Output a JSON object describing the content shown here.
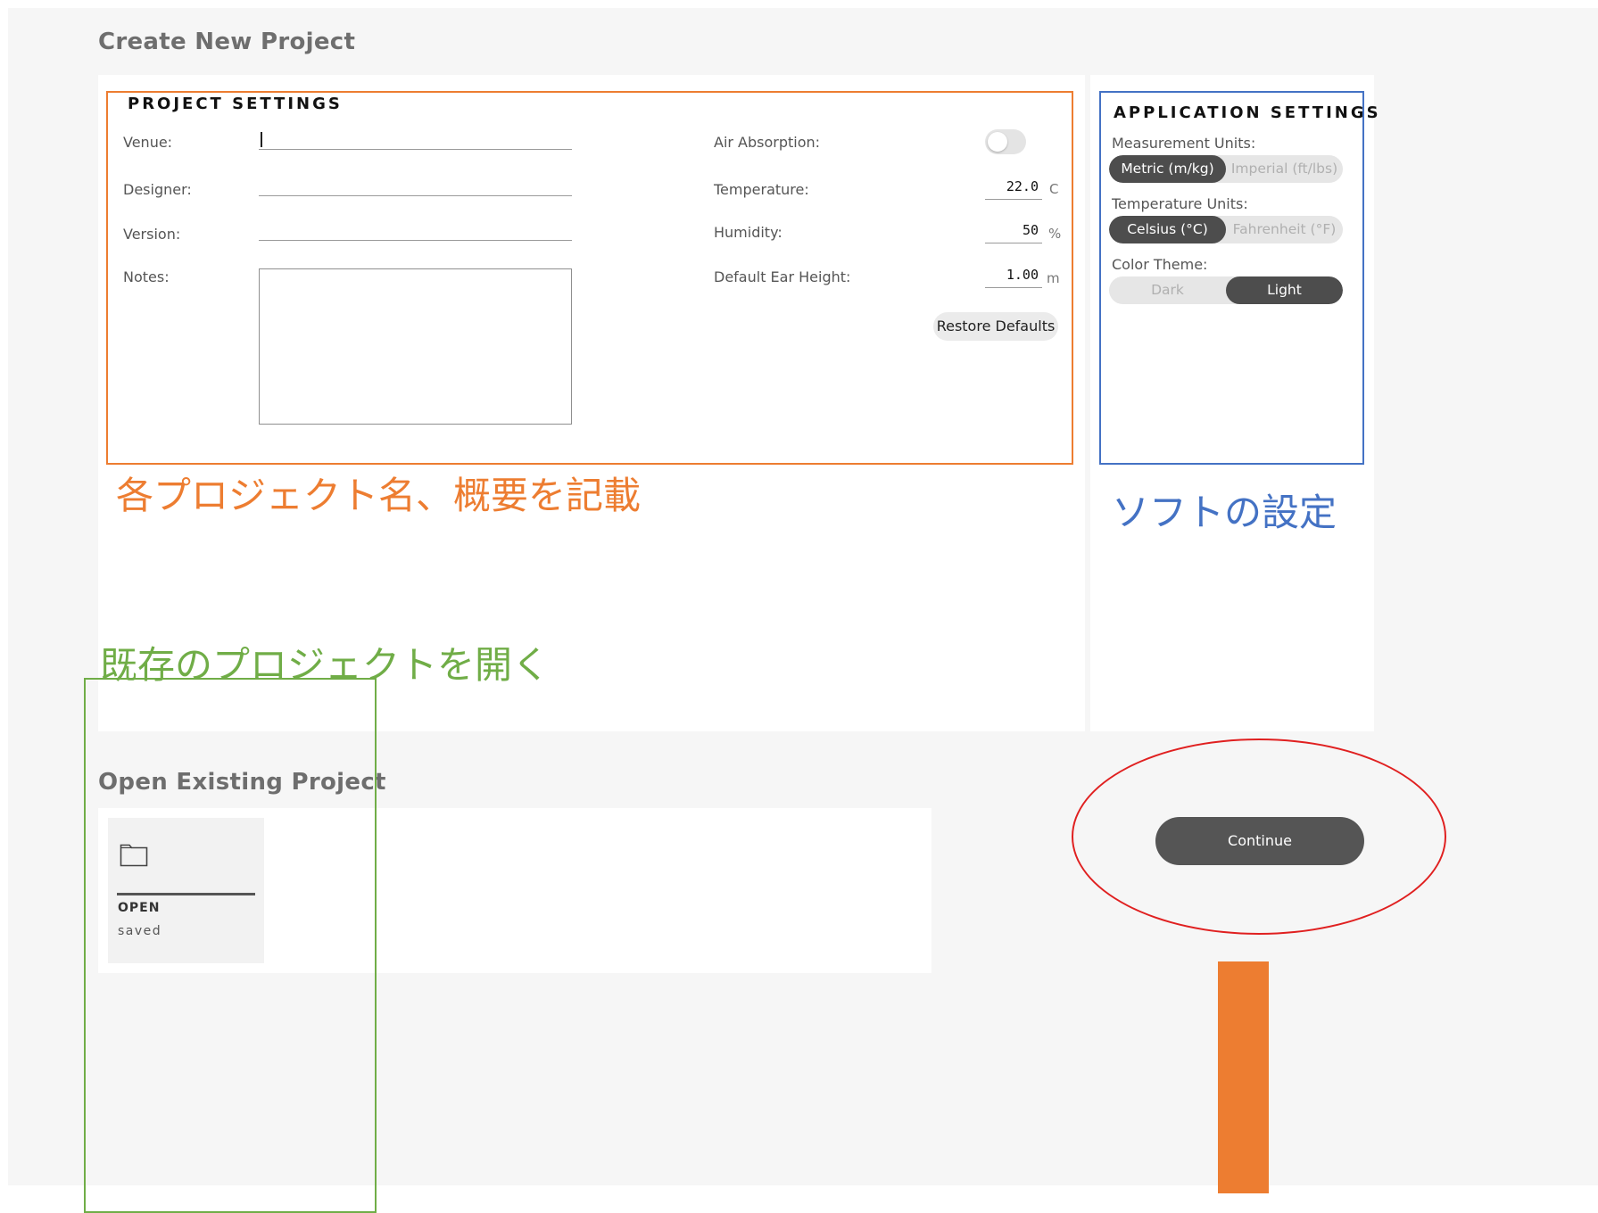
{
  "create_section": {
    "title": "Create New Project"
  },
  "project_settings": {
    "heading": "PROJECT SETTINGS",
    "venue_label": "Venue:",
    "venue_value": "",
    "designer_label": "Designer:",
    "designer_value": "",
    "version_label": "Version:",
    "version_value": "",
    "notes_label": "Notes:",
    "notes_value": "",
    "air_absorption_label": "Air Absorption:",
    "air_absorption_on": false,
    "temperature_label": "Temperature:",
    "temperature_value": "22.0",
    "temperature_unit": "C",
    "humidity_label": "Humidity:",
    "humidity_value": "50",
    "humidity_unit": "%",
    "ear_height_label": "Default Ear Height:",
    "ear_height_value": "1.00",
    "ear_height_unit": "m",
    "restore_label": "Restore Defaults"
  },
  "application_settings": {
    "heading": "APPLICATION SETTINGS",
    "measurement_label": "Measurement Units:",
    "measurement_options": [
      "Metric (m/kg)",
      "Imperial (ft/lbs)"
    ],
    "measurement_selected": "Metric (m/kg)",
    "temperature_label": "Temperature Units:",
    "temperature_options": [
      "Celsius (°C)",
      "Fahrenheit (°F)"
    ],
    "temperature_selected": "Celsius (°C)",
    "theme_label": "Color Theme:",
    "theme_options": [
      "Dark",
      "Light"
    ],
    "theme_selected": "Light"
  },
  "annotations": {
    "project_note": "各プロジェクト名、概要を記載",
    "software_note": "ソフトの設定",
    "open_note": "既存のプロジェクトを開く",
    "colors": {
      "orange": "#ed7d31",
      "blue": "#4472c4",
      "green": "#70ad47",
      "red": "#e02020"
    }
  },
  "open_section": {
    "title": "Open Existing Project",
    "card_label": "OPEN",
    "card_sub": "saved",
    "card_icon": "folder-icon"
  },
  "continue_label": "Continue"
}
